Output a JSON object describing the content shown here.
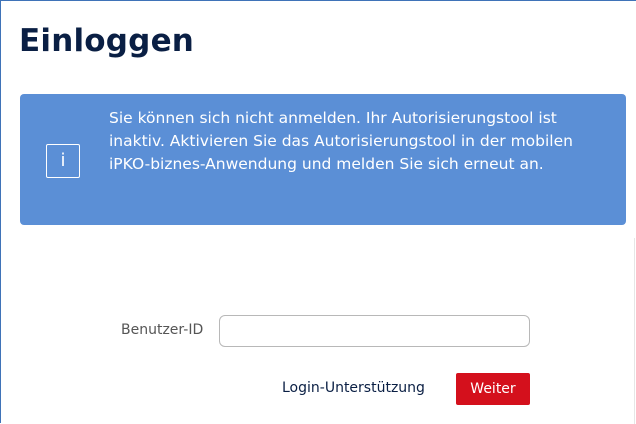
{
  "page": {
    "title": "Einloggen"
  },
  "alert": {
    "icon": "info-icon",
    "icon_glyph": "i",
    "message": "Sie können sich nicht anmelden. Ihr Autorisierungstool ist inaktiv. Aktivieren Sie das Autorisierungstool in der mobilen iPKO-biznes-Anwendung und melden Sie sich erneut an.",
    "background_color": "#5b8fd6"
  },
  "form": {
    "userid_label": "Benutzer-ID",
    "userid_value": "",
    "login_support_label": "Login-Unterstützung",
    "submit_label": "Weiter",
    "submit_color": "#d4101c"
  }
}
